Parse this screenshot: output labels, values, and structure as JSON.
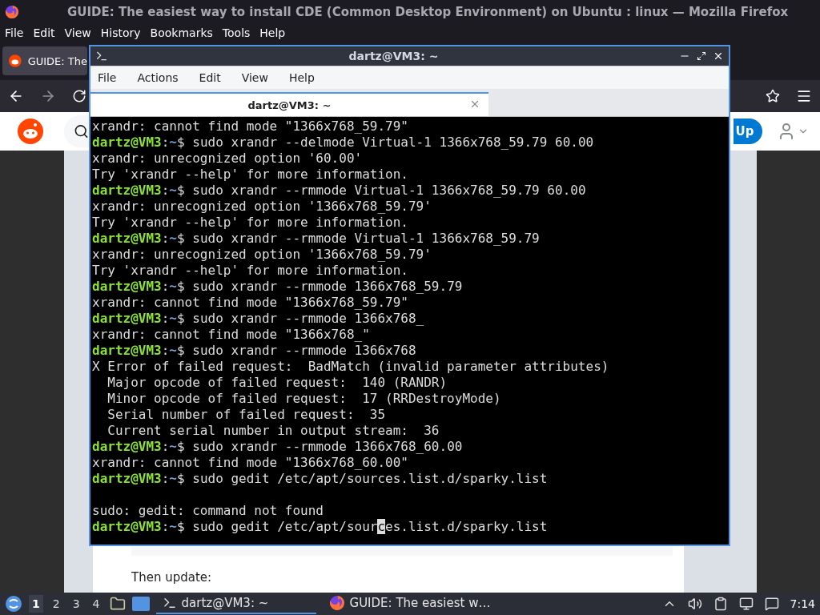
{
  "browser": {
    "title": "GUIDE: The easiest way to install CDE (Common Desktop Environment) on Ubuntu : linux — Mozilla Firefox",
    "menu": [
      {
        "label": "File"
      },
      {
        "label": "Edit"
      },
      {
        "label": "View"
      },
      {
        "label": "History"
      },
      {
        "label": "Bookmarks"
      },
      {
        "label": "Tools"
      },
      {
        "label": "Help"
      }
    ],
    "tab": {
      "title": "GUIDE: The"
    },
    "header": {
      "signup": "Up"
    },
    "page": {
      "text": "Then update:"
    }
  },
  "terminal": {
    "title": "dartz@VM3: ~",
    "menu": [
      {
        "label": "File"
      },
      {
        "label": "Actions"
      },
      {
        "label": "Edit"
      },
      {
        "label": "View"
      },
      {
        "label": "Help"
      }
    ],
    "tabs": [
      {
        "label": "dartz@VM3: ~",
        "selected": true
      }
    ],
    "lines": [
      {
        "kind": "output",
        "text": "xrandr: cannot find mode \"1366x768_59.79\""
      },
      {
        "kind": "prompt",
        "user": "dartz@VM3",
        "colon": ":",
        "dir": "~",
        "command": "$ sudo xrandr --delmode Virtual-1 1366x768_59.79 60.00"
      },
      {
        "kind": "output",
        "text": "xrandr: unrecognized option '60.00'"
      },
      {
        "kind": "output",
        "text": "Try 'xrandr --help' for more information."
      },
      {
        "kind": "prompt",
        "user": "dartz@VM3",
        "colon": ":",
        "dir": "~",
        "command": "$ sudo xrandr --rmmode Virtual-1 1366x768_59.79 60.00"
      },
      {
        "kind": "output",
        "text": "xrandr: unrecognized option '1366x768_59.79'"
      },
      {
        "kind": "output",
        "text": "Try 'xrandr --help' for more information."
      },
      {
        "kind": "prompt",
        "user": "dartz@VM3",
        "colon": ":",
        "dir": "~",
        "command": "$ sudo xrandr --rmmode Virtual-1 1366x768_59.79"
      },
      {
        "kind": "output",
        "text": "xrandr: unrecognized option '1366x768_59.79'"
      },
      {
        "kind": "output",
        "text": "Try 'xrandr --help' for more information."
      },
      {
        "kind": "prompt",
        "user": "dartz@VM3",
        "colon": ":",
        "dir": "~",
        "command": "$ sudo xrandr --rmmode 1366x768_59.79"
      },
      {
        "kind": "output",
        "text": "xrandr: cannot find mode \"1366x768_59.79\""
      },
      {
        "kind": "prompt",
        "user": "dartz@VM3",
        "colon": ":",
        "dir": "~",
        "command": "$ sudo xrandr --rmmode 1366x768_"
      },
      {
        "kind": "output",
        "text": "xrandr: cannot find mode \"1366x768_\""
      },
      {
        "kind": "prompt",
        "user": "dartz@VM3",
        "colon": ":",
        "dir": "~",
        "command": "$ sudo xrandr --rmmode 1366x768"
      },
      {
        "kind": "output",
        "text": "X Error of failed request:  BadMatch (invalid parameter attributes)"
      },
      {
        "kind": "output",
        "text": "  Major opcode of failed request:  140 (RANDR)"
      },
      {
        "kind": "output",
        "text": "  Minor opcode of failed request:  17 (RRDestroyMode)"
      },
      {
        "kind": "output",
        "text": "  Serial number of failed request:  35"
      },
      {
        "kind": "output",
        "text": "  Current serial number in output stream:  36"
      },
      {
        "kind": "prompt",
        "user": "dartz@VM3",
        "colon": ":",
        "dir": "~",
        "command": "$ sudo xrandr --rmmode 1366x768_60.00"
      },
      {
        "kind": "output",
        "text": "xrandr: cannot find mode \"1366x768_60.00\""
      },
      {
        "kind": "prompt",
        "user": "dartz@VM3",
        "colon": ":",
        "dir": "~",
        "command": "$ sudo gedit /etc/apt/sources.list.d/sparky.list"
      },
      {
        "kind": "blank"
      },
      {
        "kind": "output",
        "text": "sudo: gedit: command not found"
      },
      {
        "kind": "prompt",
        "user": "dartz@VM3",
        "colon": ":",
        "dir": "~",
        "command": "$ sudo gedit /etc/apt/sour",
        "cursor": "c",
        "rest": "es.list.d/sparky.list"
      }
    ]
  },
  "taskbar": {
    "workspaces": [
      {
        "label": "1",
        "selected": true
      },
      {
        "label": "2",
        "selected": false
      },
      {
        "label": "3",
        "selected": false
      },
      {
        "label": "4",
        "selected": false
      }
    ],
    "tasks": [
      {
        "kind": "terminal",
        "label": "dartz@VM3: ~",
        "selected": true
      },
      {
        "kind": "firefox",
        "label": "GUIDE: The easiest w…",
        "selected": false
      }
    ],
    "clock": "7:14"
  }
}
